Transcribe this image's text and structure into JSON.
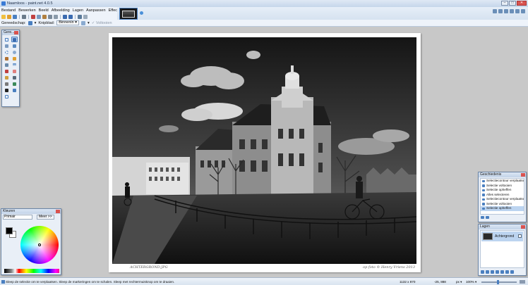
{
  "window": {
    "title": "Naamloos - paint.net 4.0.5",
    "controls": [
      "–",
      "□",
      "✕"
    ]
  },
  "menu": [
    "Bestand",
    "Bewerken",
    "Beeld",
    "Afbeelding",
    "Lagen",
    "Aanpassen",
    "Effecten"
  ],
  "tool_options": {
    "tool_label": "Gereedschap:",
    "clipping_label": "Knipblad:",
    "clipping_value": "Binnenin ▾",
    "complete_label": "Voltooien"
  },
  "tools_panel": {
    "title": "Gere..."
  },
  "photo": {
    "caption_left": "ACHTERGROND.JPG",
    "caption_right": "op foto © Henry Vriens 2013"
  },
  "colors_panel": {
    "title": "Kleuren",
    "mode_select": "Primair",
    "more_button": "Meer >>"
  },
  "history_panel": {
    "title": "Geschiedenis",
    "items": [
      {
        "label": "Selectiecontour verplaatsen",
        "selected": false
      },
      {
        "label": "Selectie voltooien",
        "selected": false
      },
      {
        "label": "Selectie opheffen",
        "selected": false
      },
      {
        "label": "Alles selecteren",
        "selected": false
      },
      {
        "label": "Selectiecontour verplaatsen",
        "selected": false
      },
      {
        "label": "Selectie voltooien",
        "selected": false
      },
      {
        "label": "Selectie opheffen",
        "selected": true
      }
    ]
  },
  "layers_panel": {
    "title": "Lagen",
    "layers": [
      {
        "name": "Achtergrond",
        "visible": true
      }
    ]
  },
  "status": {
    "hint": "Sleep de selectie om te verplaatsen. Sleep de markeringen om te schalen. Sleep met rechtermuisknop om te draaien.",
    "image_size": "1132 x 870",
    "cursor": "-25, 888",
    "unit": "px ▾",
    "zoom": "100% ▾"
  },
  "colors": {
    "accent": "#4a7fc0",
    "selection": "#bcd4f0",
    "canvas_bg": "#c8c8c8"
  }
}
